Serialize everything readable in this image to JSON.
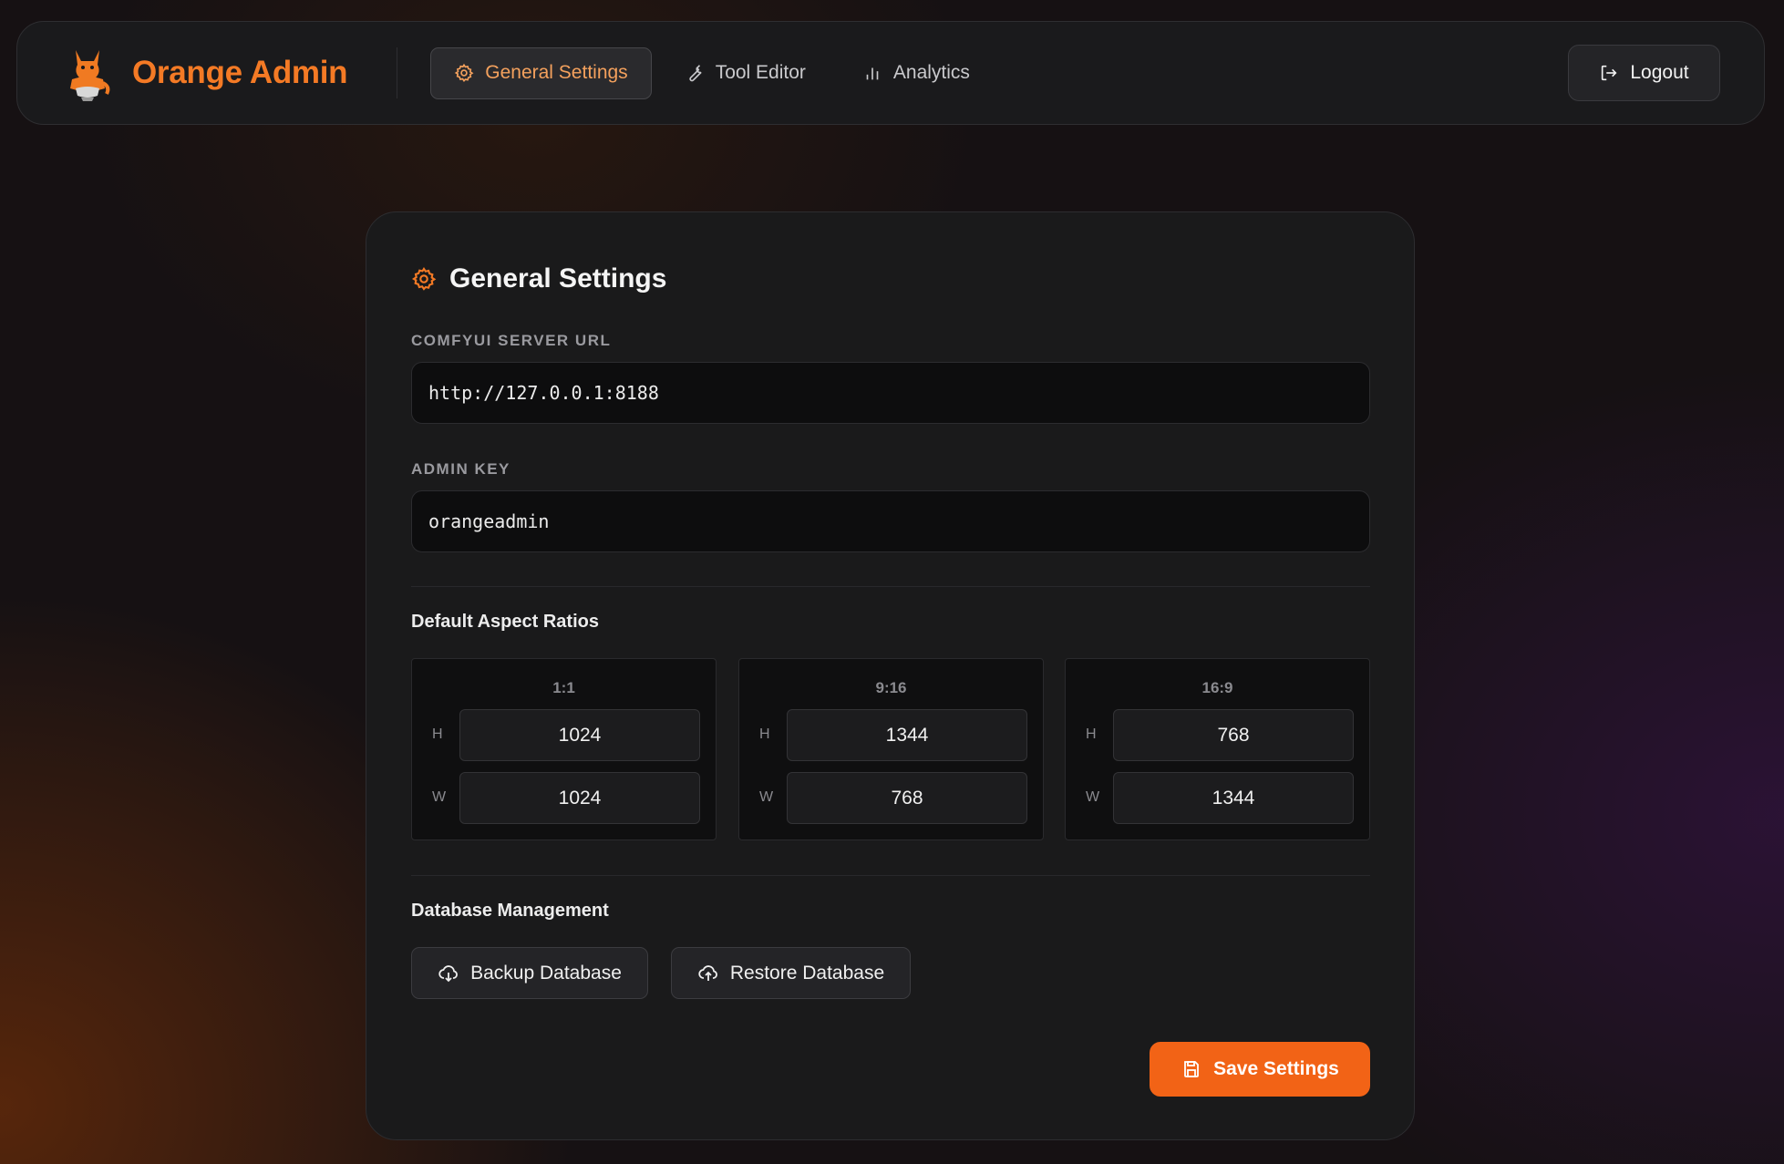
{
  "brand": {
    "title": "Orange Admin",
    "accent": "#f47a25"
  },
  "nav": {
    "items": [
      {
        "label": "General Settings",
        "icon": "gear-icon",
        "active": true
      },
      {
        "label": "Tool Editor",
        "icon": "wrench-icon",
        "active": false
      },
      {
        "label": "Analytics",
        "icon": "bar-chart-icon",
        "active": false
      }
    ],
    "logout_label": "Logout"
  },
  "settings": {
    "title": "General Settings",
    "server_url_label": "COMFYUI SERVER URL",
    "server_url_value": "http://127.0.0.1:8188",
    "admin_key_label": "ADMIN KEY",
    "admin_key_value": "orangeadmin",
    "aspect_title": "Default Aspect Ratios",
    "ratios": [
      {
        "name": "1:1",
        "h_label": "H",
        "h": "1024",
        "w_label": "W",
        "w": "1024"
      },
      {
        "name": "9:16",
        "h_label": "H",
        "h": "1344",
        "w_label": "W",
        "w": "768"
      },
      {
        "name": "16:9",
        "h_label": "H",
        "h": "768",
        "w_label": "W",
        "w": "1344"
      }
    ],
    "db_title": "Database Management",
    "backup_label": "Backup Database",
    "restore_label": "Restore Database",
    "save_label": "Save Settings",
    "save_color": "#f26316"
  }
}
